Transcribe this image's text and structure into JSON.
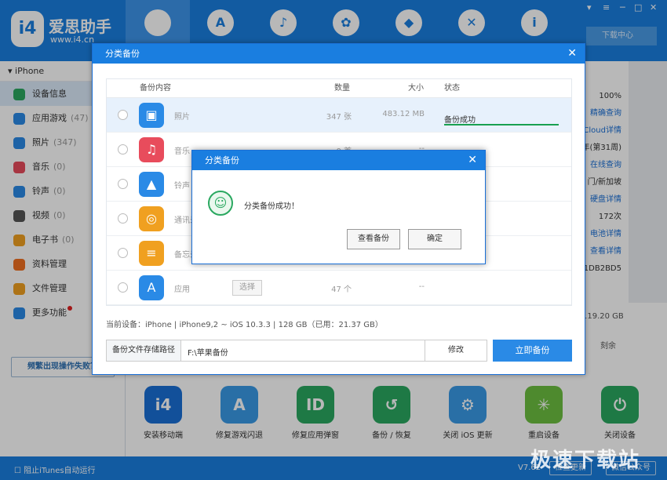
{
  "app": {
    "brand": "爱思助手",
    "url": "www.i4.cn",
    "download_center": "下载中心"
  },
  "nav": {
    "icons": [
      "apple-icon",
      "app-store-icon",
      "bell-icon",
      "flower-icon",
      "dropbox-icon",
      "tools-icon",
      "info-icon"
    ]
  },
  "sidebar": {
    "device": "iPhone",
    "items": [
      {
        "label": "设备信息",
        "count": "",
        "color": "#2aa860",
        "icon": "info-icon"
      },
      {
        "label": "应用游戏",
        "count": "(47)",
        "color": "#2a8ae6",
        "icon": "app-icon"
      },
      {
        "label": "照片",
        "count": "(347)",
        "color": "#2a8ae6",
        "icon": "photo-icon"
      },
      {
        "label": "音乐",
        "count": "(0)",
        "color": "#e84c5c",
        "icon": "music-icon"
      },
      {
        "label": "铃声",
        "count": "(0)",
        "color": "#2a8ae6",
        "icon": "bell-icon"
      },
      {
        "label": "视频",
        "count": "(0)",
        "color": "#555555",
        "icon": "video-icon"
      },
      {
        "label": "电子书",
        "count": "(0)",
        "color": "#f0a020",
        "icon": "book-icon"
      },
      {
        "label": "资料管理",
        "count": "",
        "color": "#f07020",
        "icon": "contacts-icon"
      },
      {
        "label": "文件管理",
        "count": "",
        "color": "#f0a020",
        "icon": "folder-icon"
      },
      {
        "label": "更多功能",
        "count": "",
        "color": "#2a8ae6",
        "icon": "grid-icon"
      }
    ],
    "fail_button": "频繁出现操作失败？"
  },
  "right_info": [
    "100%",
    "精确查询",
    "Cloud详情",
    "年(第31周)",
    "在线查询",
    "门/新加坡",
    "硬盘详情",
    "172次",
    "电池详情",
    "查看详情",
    "1DB2BD5"
  ],
  "storage": "119.20 GB",
  "erase": "刻余",
  "tools": [
    {
      "label": "安装移动端",
      "color": "#1a6fd6",
      "glyph": "i4"
    },
    {
      "label": "修复游戏闪退",
      "color": "#3a9ae6",
      "glyph": "A"
    },
    {
      "label": "修复应用弹窗",
      "color": "#2aa860",
      "glyph": "ID"
    },
    {
      "label": "备份 / 恢复",
      "color": "#2aa860",
      "glyph": "↺"
    },
    {
      "label": "关闭 iOS 更新",
      "color": "#3a9ae6",
      "glyph": "⚙"
    },
    {
      "label": "重启设备",
      "color": "#6cc040",
      "glyph": "✳"
    },
    {
      "label": "关闭设备",
      "color": "#2aa860",
      "glyph": "⏻"
    }
  ],
  "status_bar": {
    "itunes": "阻止iTunes自动运行",
    "version": "V7.62",
    "check_update": "检查更新",
    "wechat": "微信公众号"
  },
  "backup_dialog": {
    "title": "分类备份",
    "headers": {
      "content": "备份内容",
      "qty": "数量",
      "size": "大小",
      "status": "状态"
    },
    "rows": [
      {
        "name": "照片",
        "qty": "347 张",
        "size": "483.12 MB",
        "status": "备份成功",
        "color": "#2a8ae6",
        "glyph": "▣"
      },
      {
        "name": "音乐",
        "qty": "0 首",
        "size": "--",
        "status": "",
        "color": "#e84c5c",
        "glyph": "♫"
      },
      {
        "name": "铃声",
        "qty": "",
        "size": "",
        "status": "",
        "color": "#2a8ae6",
        "glyph": "▲"
      },
      {
        "name": "通讯录",
        "qty": "",
        "size": "",
        "status": "",
        "color": "#f0a020",
        "glyph": "◎"
      },
      {
        "name": "备忘录",
        "qty": "",
        "size": "",
        "status": "",
        "color": "#f0a020",
        "glyph": "≡"
      },
      {
        "name": "应用",
        "qty": "47 个",
        "size": "--",
        "status": "",
        "color": "#2a8ae6",
        "glyph": "A"
      }
    ],
    "select_label": "选择",
    "device_info": "当前设备：iPhone  |  iPhone9,2 ~ iOS 10.3.3  |  128 GB（已用：21.37 GB）",
    "path_label": "备份文件存储路径",
    "path_value": "F:\\苹果备份",
    "modify": "修改",
    "backup_now": "立即备份"
  },
  "success_dialog": {
    "title": "分类备份",
    "message": "分类备份成功！",
    "view": "查看备份",
    "ok": "确定"
  },
  "watermark": "极速下载站"
}
